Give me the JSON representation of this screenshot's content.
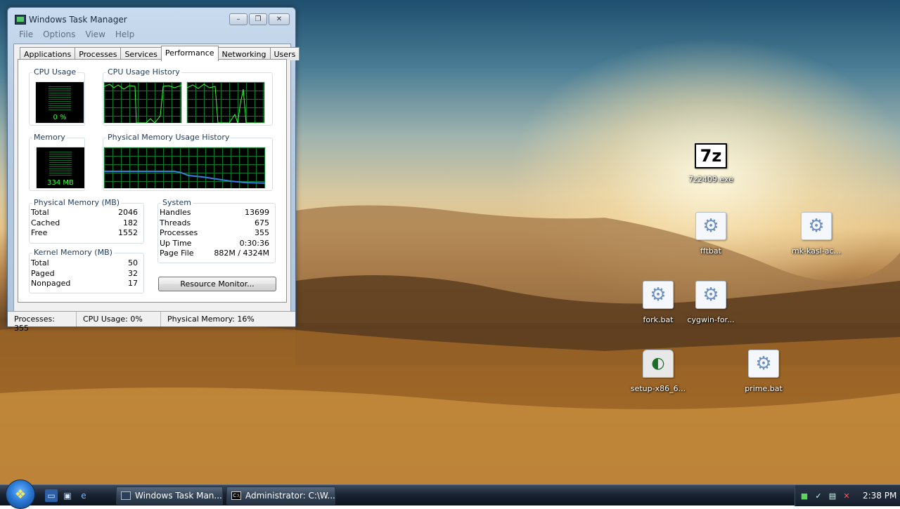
{
  "window": {
    "title": "Windows Task Manager",
    "min_label": "–",
    "max_label": "❐",
    "close_label": "✕"
  },
  "menu": [
    "File",
    "Options",
    "View",
    "Help"
  ],
  "tabs": [
    "Applications",
    "Processes",
    "Services",
    "Performance",
    "Networking",
    "Users"
  ],
  "active_tab": "Performance",
  "performance": {
    "cpu_usage_label": "CPU Usage",
    "cpu_usage_value": "0 %",
    "cpu_history_label": "CPU Usage History",
    "memory_label": "Memory",
    "memory_value": "334 MB",
    "phys_history_label": "Physical Memory Usage History",
    "physical_memory": {
      "title": "Physical Memory (MB)",
      "rows": [
        {
          "label": "Total",
          "value": "2046"
        },
        {
          "label": "Cached",
          "value": "182"
        },
        {
          "label": "Free",
          "value": "1552"
        }
      ]
    },
    "kernel_memory": {
      "title": "Kernel Memory (MB)",
      "rows": [
        {
          "label": "Total",
          "value": "50"
        },
        {
          "label": "Paged",
          "value": "32"
        },
        {
          "label": "Nonpaged",
          "value": "17"
        }
      ]
    },
    "system": {
      "title": "System",
      "rows": [
        {
          "label": "Handles",
          "value": "13699"
        },
        {
          "label": "Threads",
          "value": "675"
        },
        {
          "label": "Processes",
          "value": "355"
        },
        {
          "label": "Up Time",
          "value": "0:30:36"
        },
        {
          "label": "Page File",
          "value": "882M / 4324M"
        }
      ]
    },
    "resource_monitor_label": "Resource Monitor..."
  },
  "statusbar": {
    "processes": "Processes: 355",
    "cpu": "CPU Usage: 0%",
    "memory": "Physical Memory: 16%"
  },
  "desktop_icons": [
    {
      "label": "7z2409.exe",
      "icon": "7z-icon"
    },
    {
      "label": "fftbat",
      "icon": "batch-file-icon"
    },
    {
      "label": "mk-kasl-ac...",
      "icon": "batch-file-icon"
    },
    {
      "label": "fork.bat",
      "icon": "batch-file-icon"
    },
    {
      "label": "cygwin-for...",
      "icon": "batch-file-icon"
    },
    {
      "label": "setup-x86_6...",
      "icon": "cygwin-setup-icon"
    },
    {
      "label": "prime.bat",
      "icon": "batch-file-icon"
    }
  ],
  "taskbar": {
    "buttons": [
      {
        "label": "Windows Task Man...",
        "icon": "task-manager-icon"
      },
      {
        "label": "Administrator: C:\\W...",
        "icon": "cmd-icon"
      }
    ],
    "clock": "2:38 PM"
  },
  "colors": {
    "graph_bg": "#000000",
    "graph_grid": "#0b7a2f",
    "graph_line": "#3bff3b",
    "memory_line": "#3a7fe0"
  }
}
